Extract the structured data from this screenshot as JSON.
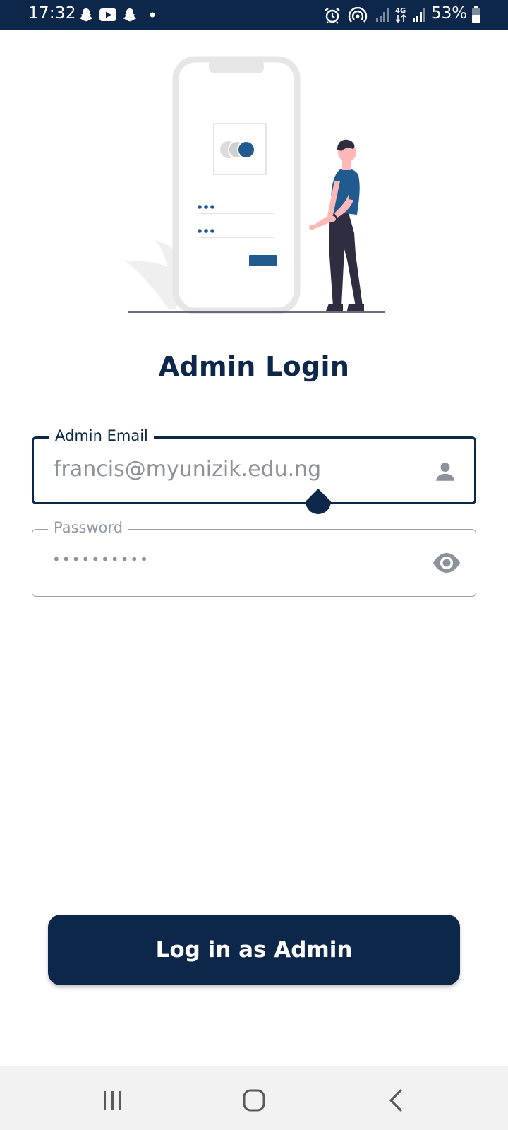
{
  "status_bar": {
    "time": "17:32",
    "battery_percent": "53%",
    "notification_icons": [
      "snapchat-icon",
      "youtube-icon",
      "snapchat-icon",
      "dot-icon"
    ],
    "system_icons": [
      "alarm-icon",
      "hotspot-icon",
      "signal-icon",
      "4g-icon",
      "signal-icon",
      "battery-icon"
    ]
  },
  "page": {
    "title": "Admin Login"
  },
  "email_field": {
    "label": "Admin Email",
    "value": "francis@myunizik.edu.ng",
    "icon": "person-icon"
  },
  "password_field": {
    "label": "Password",
    "value": "••••••••••",
    "icon": "eye-icon"
  },
  "login_button": {
    "label": "Log in as Admin"
  },
  "colors": {
    "primary": "#0c2749",
    "accent": "#215a8e",
    "muted": "#8b9299",
    "nav_bg": "#f2f2f2"
  }
}
